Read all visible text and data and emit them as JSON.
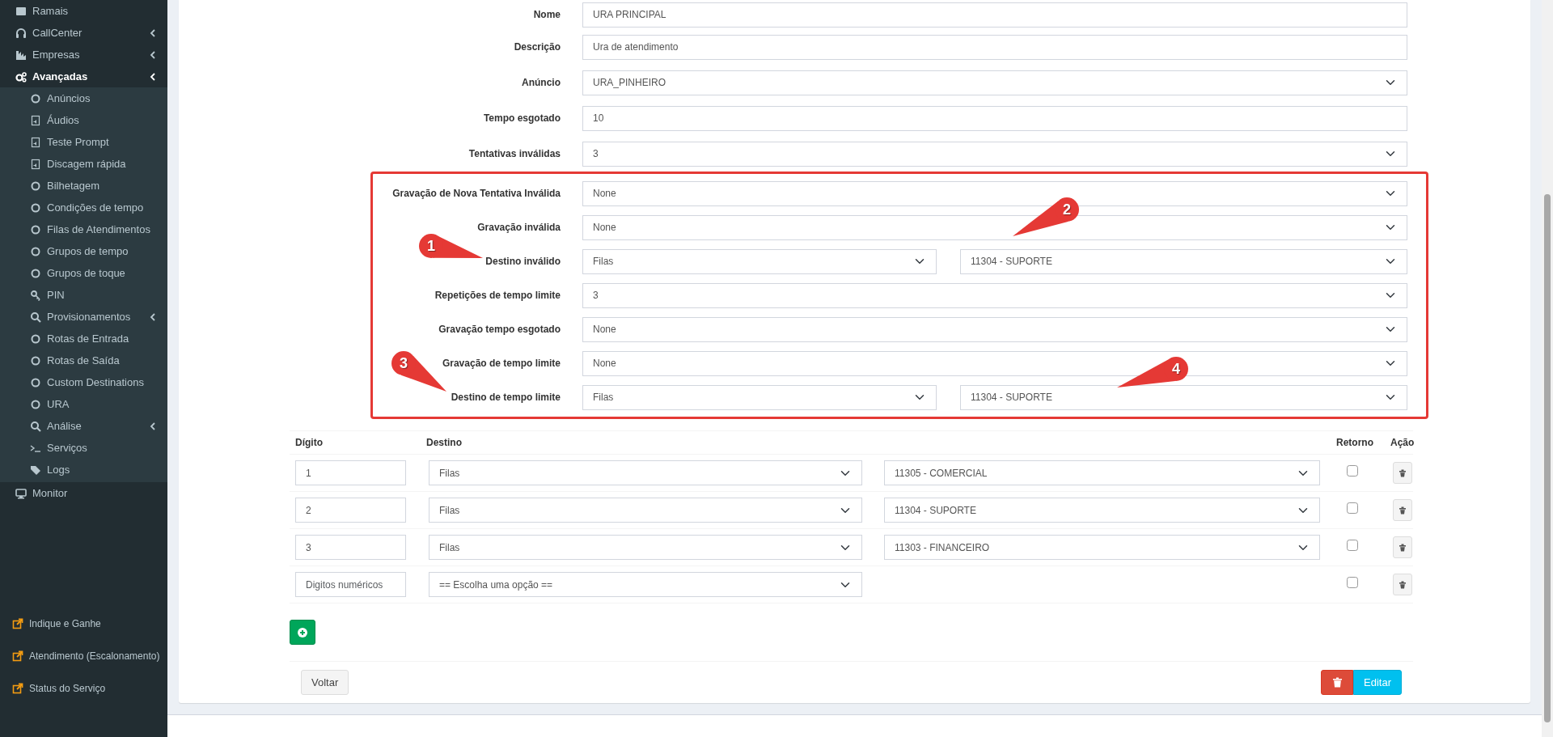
{
  "sidebar": {
    "items": [
      {
        "label": "Ramais",
        "selected": false,
        "submenu": false
      },
      {
        "label": "CallCenter",
        "selected": false,
        "submenu": true
      },
      {
        "label": "Empresas",
        "selected": false,
        "submenu": true
      },
      {
        "label": "Avançadas",
        "selected": true,
        "submenu": true,
        "expanded": true,
        "children": [
          {
            "label": "Anúncios",
            "selected": false,
            "submenu": false
          },
          {
            "label": "Áudios",
            "selected": false,
            "submenu": false
          },
          {
            "label": "Teste Prompt",
            "selected": false,
            "submenu": false
          },
          {
            "label": "Discagem rápida",
            "selected": false,
            "submenu": false
          },
          {
            "label": "Bilhetagem",
            "selected": false,
            "submenu": false
          },
          {
            "label": "Condições de tempo",
            "selected": false,
            "submenu": false
          },
          {
            "label": "Filas de Atendimentos",
            "selected": false,
            "submenu": false
          },
          {
            "label": "Grupos de tempo",
            "selected": false,
            "submenu": false
          },
          {
            "label": "Grupos de toque",
            "selected": false,
            "submenu": false
          },
          {
            "label": "PIN",
            "selected": false,
            "submenu": false
          },
          {
            "label": "Provisionamentos",
            "selected": false,
            "submenu": true
          },
          {
            "label": "Rotas de Entrada",
            "selected": false,
            "submenu": false
          },
          {
            "label": "Rotas de Saída",
            "selected": false,
            "submenu": false
          },
          {
            "label": "Custom Destinations",
            "selected": false,
            "submenu": false
          },
          {
            "label": "URA",
            "selected": false,
            "submenu": false
          },
          {
            "label": "Análise",
            "selected": false,
            "submenu": true
          },
          {
            "label": "Serviços",
            "selected": false,
            "submenu": false
          },
          {
            "label": "Logs",
            "selected": false,
            "submenu": false
          }
        ]
      },
      {
        "label": "Monitor",
        "selected": false,
        "submenu": false
      }
    ],
    "links": [
      {
        "label": "Indique e Ganhe"
      },
      {
        "label": "Atendimento (Escalonamento)"
      },
      {
        "label": "Status do Serviço"
      }
    ]
  },
  "form": {
    "fields": [
      {
        "label": "Nome",
        "kind": "input",
        "value": "URA PRINCIPAL"
      },
      {
        "label": "Descrição",
        "kind": "input",
        "value": "Ura de atendimento"
      },
      {
        "label": "Anúncio",
        "kind": "select",
        "value": "URA_PINHEIRO"
      },
      {
        "label": "Tempo esgotado",
        "kind": "input",
        "value": "10"
      },
      {
        "label": "Tentativas inválidas",
        "kind": "select",
        "value": "3"
      }
    ],
    "highlighted_fields": [
      {
        "label": "Gravação de Nova Tentativa Inválida",
        "kind": "select",
        "value": "None"
      },
      {
        "label": "Gravação inválida",
        "kind": "select",
        "value": "None"
      },
      {
        "label": "Destino inválido",
        "kind": "select-pair",
        "value": "Filas",
        "value_2": "11304 - SUPORTE"
      },
      {
        "label": "Repetições de tempo limite",
        "kind": "select",
        "value": "3"
      },
      {
        "label": "Gravação tempo esgotado",
        "kind": "select",
        "value": "None"
      },
      {
        "label": "Gravação de tempo limite",
        "kind": "select",
        "value": "None"
      },
      {
        "label": "Destino de tempo limite",
        "kind": "select-pair",
        "value": "Filas",
        "value_2": "11304 - SUPORTE"
      }
    ],
    "callouts": [
      "1",
      "2",
      "3",
      "4"
    ]
  },
  "digits_table": {
    "columns": [
      "Dígito",
      "Destino",
      "Retorno",
      "Ação"
    ],
    "rows": [
      {
        "digit": "1",
        "destination": "Filas",
        "target": "11305 - COMERCIAL",
        "returned": false
      },
      {
        "digit": "2",
        "destination": "Filas",
        "target": "11304 - SUPORTE",
        "returned": false
      },
      {
        "digit": "3",
        "destination": "Filas",
        "target": "11303 - FINANCEIRO",
        "returned": false
      },
      {
        "placeholder": "Digitos numéricos",
        "destination": "== Escolha uma opção ==",
        "returned": false
      }
    ]
  },
  "actions": {
    "back": "Voltar",
    "edit": "Editar"
  }
}
